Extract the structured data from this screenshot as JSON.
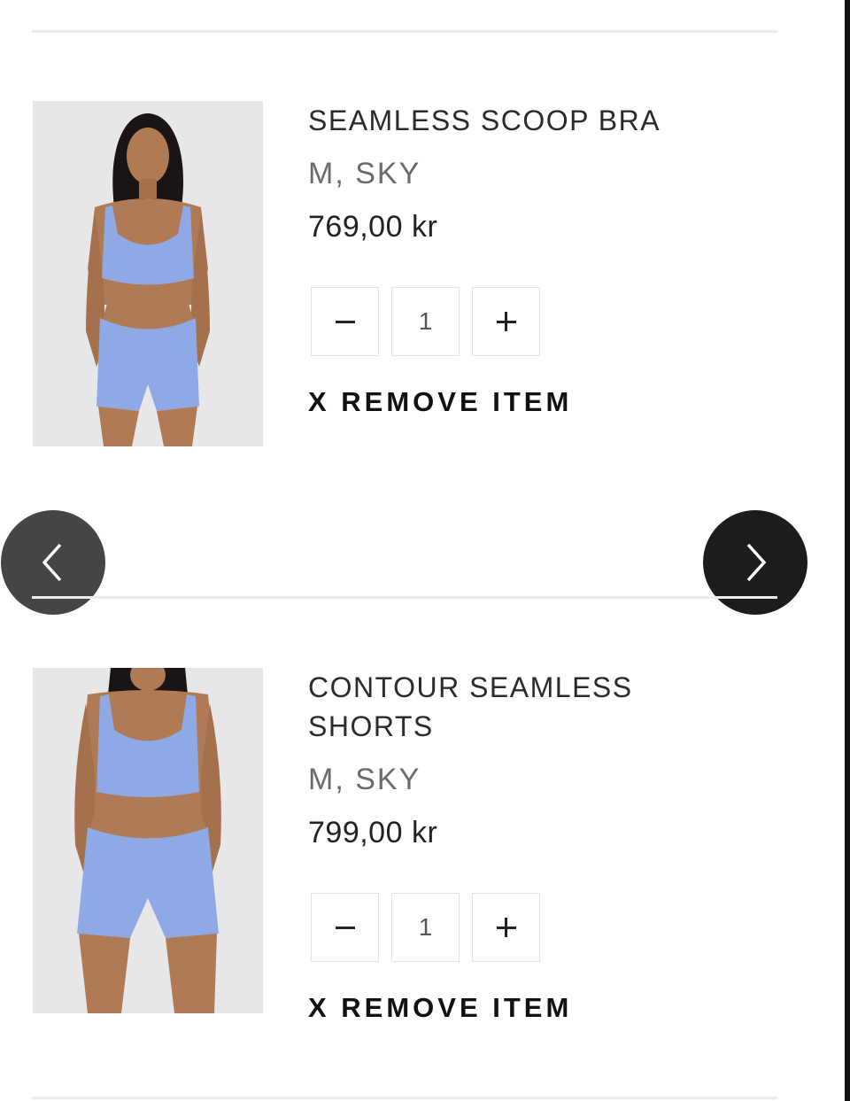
{
  "cart": {
    "items": [
      {
        "name": "SEAMLESS SCOOP BRA",
        "variant": "M, SKY",
        "price": "769,00 kr",
        "quantity": "1",
        "remove_label": "X REMOVE ITEM"
      },
      {
        "name": "CONTOUR SEAMLESS SHORTS",
        "variant": "M, SKY",
        "price": "799,00 kr",
        "quantity": "1",
        "remove_label": "X REMOVE ITEM"
      }
    ]
  },
  "icons": {
    "minus": "minus-icon",
    "plus": "plus-icon",
    "prev": "chevron-left-icon",
    "next": "chevron-right-icon"
  },
  "colors": {
    "product_color": "#8fa9e6",
    "skin": "#b07a55",
    "hair": "#1a1414",
    "image_bg": "#e7e7ea",
    "prev_button": "#454545",
    "next_button": "#1c1c1c"
  }
}
